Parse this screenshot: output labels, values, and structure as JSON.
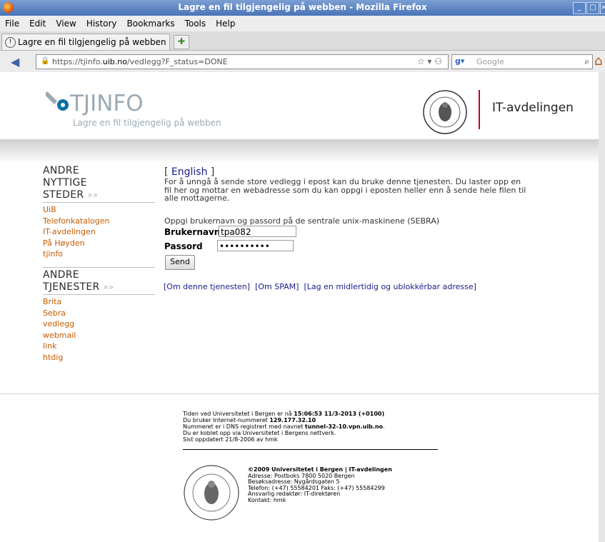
{
  "window": {
    "title": "Lagre en fil tilgjengelig på webben - Mozilla Firefox"
  },
  "menubar": [
    "File",
    "Edit",
    "View",
    "History",
    "Bookmarks",
    "Tools",
    "Help"
  ],
  "tabs": [
    {
      "label": "Lagre en fil tilgjengelig på webben"
    }
  ],
  "navbar": {
    "url_prefix": "https://tjinfo.",
    "url_domain": "uib.no",
    "url_suffix": "/vedlegg?F_status=DONE",
    "search_placeholder": "Google"
  },
  "header": {
    "logo_title": "TJINFO",
    "logo_subtitle": "Lagre en fil tilgjengelig på webben",
    "department": "IT-avdelingen"
  },
  "sidebar": {
    "group1_title_line1": "ANDRE",
    "group1_title_line2": "NYTTIGE",
    "group1_title_line3": "STEDER",
    "group1_links": [
      "UiB",
      "Telefonkatalogen",
      "IT-avdelingen",
      "På Høyden",
      "tjinfo"
    ],
    "group2_title_line1": "ANDRE",
    "group2_title_line2": "TJENESTER",
    "group2_links": [
      "Brita",
      "Sebra",
      "vedlegg",
      "webmail",
      "link",
      "htdig"
    ],
    "arrow": "»»"
  },
  "main": {
    "english_open": "[ ",
    "english_link": "English",
    "english_close": " ]",
    "intro_line1": "For å unngå å sende store vedlegg i epost kan du bruke denne tjenesten. Du laster opp en",
    "intro_line2": "fil her og mottar en webadresse som du kan oppgi i eposten heller enn å sende hele filen til",
    "intro_line3": "alle mottagerne.",
    "login_prompt": "Oppgi brukernavn og passord på de sentrale unix-maskinene (SEBRA)",
    "username_label": "Brukernavn",
    "username_value": "tpa082",
    "password_label": "Passord",
    "password_value": "••••••••••",
    "send_label": "Send",
    "link1": "[Om denne tjenesten]",
    "link2": "[Om SPAM]",
    "link3": "[Lag en midlertidig og ublokkérbar adresse]"
  },
  "footer": {
    "time_prefix": "Tiden ved Universitetet i Bergen er nå ",
    "time_value": "15:06:53 11/3-2013 (+0100)",
    "ip_prefix": "Du bruker Internet-nummeret ",
    "ip_value": "129.177.32.10",
    "dns_prefix": "Nummeret er i DNS registrert med navnet ",
    "dns_value": "tunnel-32-10.vpn.uib.no",
    "dns_suffix": ".",
    "network": "Du er koblet opp via Universitetet i Bergens nettverk.",
    "updated": "Sist oppdatert 21/8-2006 av hmk",
    "copyright": "©2009 Universitetet i Bergen | IT-avdelingen",
    "address": "Adresse: Postboks 7800 5020 Bergen",
    "visit": "Besøksadresse: Nygårdsgaten 5",
    "phone": "Telefon: (+47) 55584201 Faks: (+47) 55584299",
    "editor": "Ansvarlig redaktør: IT-direktøren",
    "contact": "Kontakt: hmk"
  }
}
